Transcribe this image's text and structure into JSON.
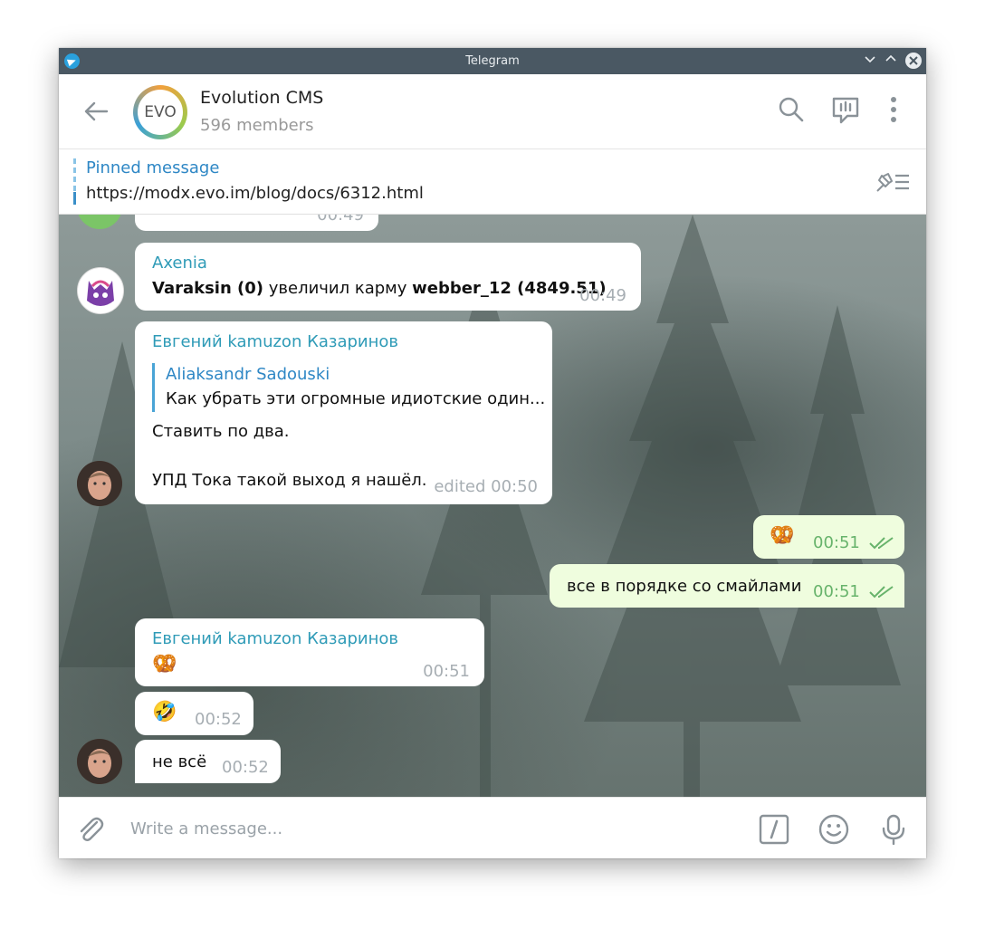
{
  "window": {
    "title": "Telegram"
  },
  "header": {
    "chat_name": "Evolution CMS",
    "members": "596 members",
    "avatar_text": "EVO"
  },
  "pinned": {
    "label": "Pinned message",
    "text": "https://modx.evo.im/blog/docs/6312.html"
  },
  "messages": {
    "cut_off": {
      "time": "00:49"
    },
    "m1": {
      "author": "Axenia",
      "bold1": "Varaksin (0)",
      "text_mid": " увеличил карму ",
      "bold2": "webber_12 (4849.51)",
      "time": "00:49"
    },
    "m2": {
      "author": "Евгений kamuzon Казаринов",
      "reply_author": "Aliaksandr Sadouski",
      "reply_text": "Как убрать эти огромные идиотские один...",
      "line1": "Ставить по два.",
      "line2": "УПД Тока такой выход я нашёл.",
      "time": "edited 00:50"
    },
    "out1": {
      "emoji": "🥨",
      "time": "00:51"
    },
    "out2": {
      "text": "все в порядке со смайлами",
      "time": "00:51"
    },
    "m3": {
      "author": "Евгений kamuzon Казаринов",
      "emoji": "🥨",
      "time": "00:51"
    },
    "m4": {
      "emoji": "🤣",
      "time": "00:52"
    },
    "m5": {
      "text": "не всё",
      "time": "00:52"
    }
  },
  "composer": {
    "placeholder": "Write a message..."
  },
  "icons": {
    "back": "arrow-left-icon",
    "search": "search-icon",
    "discuss": "discussion-icon",
    "more": "more-vertical-icon",
    "pin_list": "pinned-list-icon",
    "attach": "paperclip-icon",
    "commands": "slash-command-icon",
    "emoji": "emoji-icon",
    "mic": "microphone-icon"
  },
  "colors": {
    "link": "#2e87c5",
    "author": "#2f9bb7",
    "outgoing_bubble": "#effdde",
    "outgoing_time": "#67b36b"
  }
}
